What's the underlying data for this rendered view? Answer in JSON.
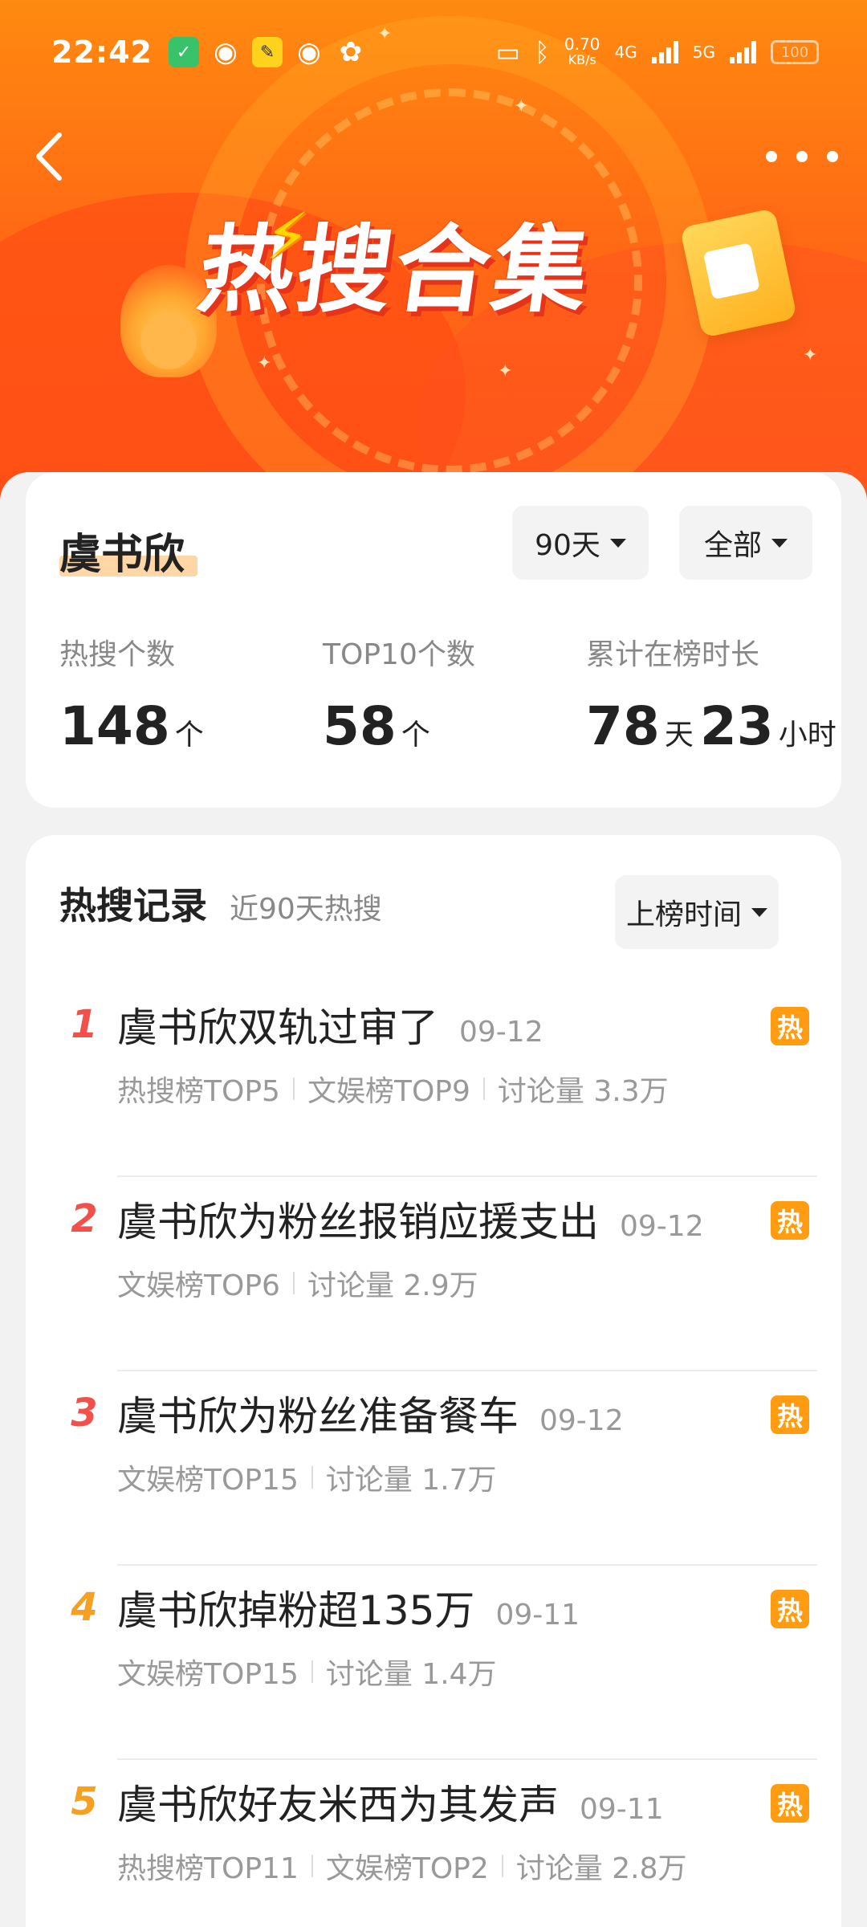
{
  "status_bar": {
    "time": "22:42",
    "net_speed_value": "0.70",
    "net_speed_unit": "KB/s",
    "network_1": "4G",
    "network_2": "5G",
    "battery": "100",
    "icons": [
      "check-app-icon",
      "weibo-icon",
      "chat-app-icon",
      "weibo-icon",
      "game-app-icon",
      "bed-icon",
      "bluetooth-icon"
    ]
  },
  "banner": {
    "title": "热搜合集",
    "back_icon": "back-chevron-icon",
    "more_icon": "more-dots-icon"
  },
  "summary": {
    "name": "虞书欣",
    "range_filter": "90天",
    "type_filter": "全部",
    "stats": [
      {
        "label": "热搜个数",
        "value": "148",
        "unit": "个"
      },
      {
        "label": "TOP10个数",
        "value": "58",
        "unit": "个"
      },
      {
        "label": "累计在榜时长",
        "value_days": "78",
        "unit_days": "天",
        "value_hours": "23",
        "unit_hours": "小时"
      }
    ]
  },
  "records": {
    "title": "热搜记录",
    "subtitle": "近90天热搜",
    "sort_label": "上榜时间",
    "hot_badge": "热",
    "items": [
      {
        "rank": "1",
        "title": "虞书欣双轨过审了",
        "date": "09-12",
        "meta": [
          "热搜榜TOP5",
          "文娱榜TOP9",
          "讨论量 3.3万"
        ]
      },
      {
        "rank": "2",
        "title": "虞书欣为粉丝报销应援支出",
        "date": "09-12",
        "meta": [
          "文娱榜TOP6",
          "讨论量 2.9万"
        ]
      },
      {
        "rank": "3",
        "title": "虞书欣为粉丝准备餐车",
        "date": "09-12",
        "meta": [
          "文娱榜TOP15",
          "讨论量 1.7万"
        ]
      },
      {
        "rank": "4",
        "title": "虞书欣掉粉超135万",
        "date": "09-11",
        "meta": [
          "文娱榜TOP15",
          "讨论量 1.4万"
        ]
      },
      {
        "rank": "5",
        "title": "虞书欣好友米西为其发声",
        "date": "09-11",
        "meta": [
          "热搜榜TOP11",
          "文娱榜TOP2",
          "讨论量 2.8万"
        ]
      }
    ]
  },
  "colors": {
    "banner_top": "#ff8a10",
    "banner_bottom": "#ff5a1a",
    "rank_top3": "#f2504a",
    "rank_other": "#f5a020",
    "hot_badge": "#ff9c12"
  }
}
